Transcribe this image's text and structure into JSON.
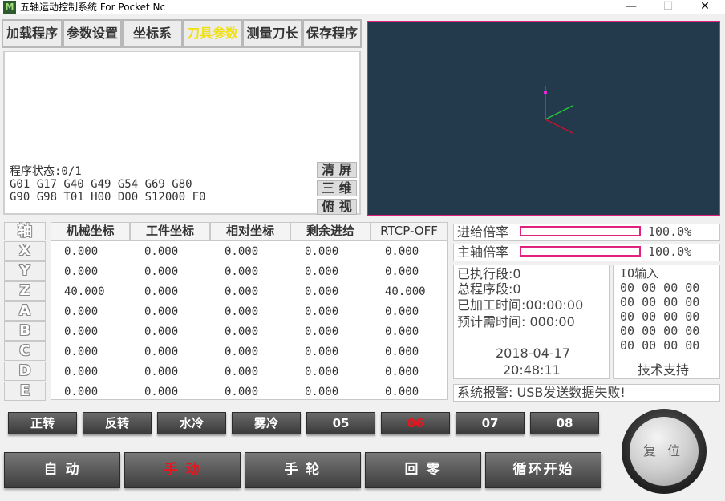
{
  "window": {
    "title": "五轴运动控制系统 For Pocket Nc",
    "icon_text": "M",
    "minimize": "—",
    "maximize": "☐",
    "close": "✕"
  },
  "tabs": [
    {
      "label": "加载程序"
    },
    {
      "label": "参数设置"
    },
    {
      "label": "坐标系"
    },
    {
      "label": "刀具参数",
      "active": true
    },
    {
      "label": "测量刀长"
    },
    {
      "label": "保存程序"
    }
  ],
  "program": {
    "status": "程序状态:0/1",
    "line1": "G01 G17 G40 G49 G54 G69 G80",
    "line2": "G90 G98 T01 H00 D00 S12000 F0",
    "btn_clear": "清 屏",
    "btn_3d": "三 维",
    "btn_top": "俯 视"
  },
  "table": {
    "axis_header": "轴",
    "headers": [
      "机械坐标",
      "工件坐标",
      "相对坐标",
      "剩余进给",
      "RTCP-OFF"
    ],
    "axes": [
      "X",
      "Y",
      "Z",
      "A",
      "B",
      "C",
      "D",
      "E"
    ],
    "rows": [
      [
        "0.000",
        "0.000",
        "0.000",
        "0.000",
        "0.000"
      ],
      [
        "0.000",
        "0.000",
        "0.000",
        "0.000",
        "0.000"
      ],
      [
        "40.000",
        "0.000",
        "0.000",
        "0.000",
        "40.000"
      ],
      [
        "0.000",
        "0.000",
        "0.000",
        "0.000",
        "0.000"
      ],
      [
        "0.000",
        "0.000",
        "0.000",
        "0.000",
        "0.000"
      ],
      [
        "0.000",
        "0.000",
        "0.000",
        "0.000",
        "0.000"
      ],
      [
        "0.000",
        "0.000",
        "0.000",
        "0.000",
        "0.000"
      ],
      [
        "0.000",
        "0.000",
        "0.000",
        "0.000",
        "0.000"
      ]
    ]
  },
  "rates": {
    "feed_label": "进给倍率",
    "feed_value": "100.0%",
    "feed_fraction": 1.0,
    "spindle_label": "主轴倍率",
    "spindle_value": "100.0%",
    "spindle_fraction": 1.0
  },
  "info": {
    "executed": "已执行段:0",
    "total": "总程序段:0",
    "elapsed": "已加工时间:00:00:00",
    "estimated": "预计需时间: 000:00",
    "date": "2018-04-17",
    "time": "20:48:11"
  },
  "io": {
    "title": "IO输入",
    "lines": [
      "00 00 00 00",
      "00 00 00 00",
      "00 00 00 00",
      "00 00 00 00",
      "00 00 00 00"
    ],
    "support": "技术支持"
  },
  "alarm": "系统报警: USB发送数据失败!",
  "m_buttons": [
    {
      "label": "正转",
      "red": false
    },
    {
      "label": "反转",
      "red": false
    },
    {
      "label": "水冷",
      "red": false
    },
    {
      "label": "雾冷",
      "red": false
    },
    {
      "label": "05",
      "red": false
    },
    {
      "label": "06",
      "red": true
    },
    {
      "label": "07",
      "red": false
    },
    {
      "label": "08",
      "red": false
    }
  ],
  "mode_buttons": [
    {
      "label": "自  动",
      "red": false
    },
    {
      "label": "手  动",
      "red": true
    },
    {
      "label": "手  轮",
      "red": false
    },
    {
      "label": "回  零",
      "red": false
    },
    {
      "label": "循环开始",
      "red": false
    }
  ],
  "reset_label": "复位",
  "colors": {
    "accent": "#e0217e",
    "viewport_bg": "#223a4c",
    "active_tab": "#f0e010",
    "red_text": "#e8141e"
  }
}
